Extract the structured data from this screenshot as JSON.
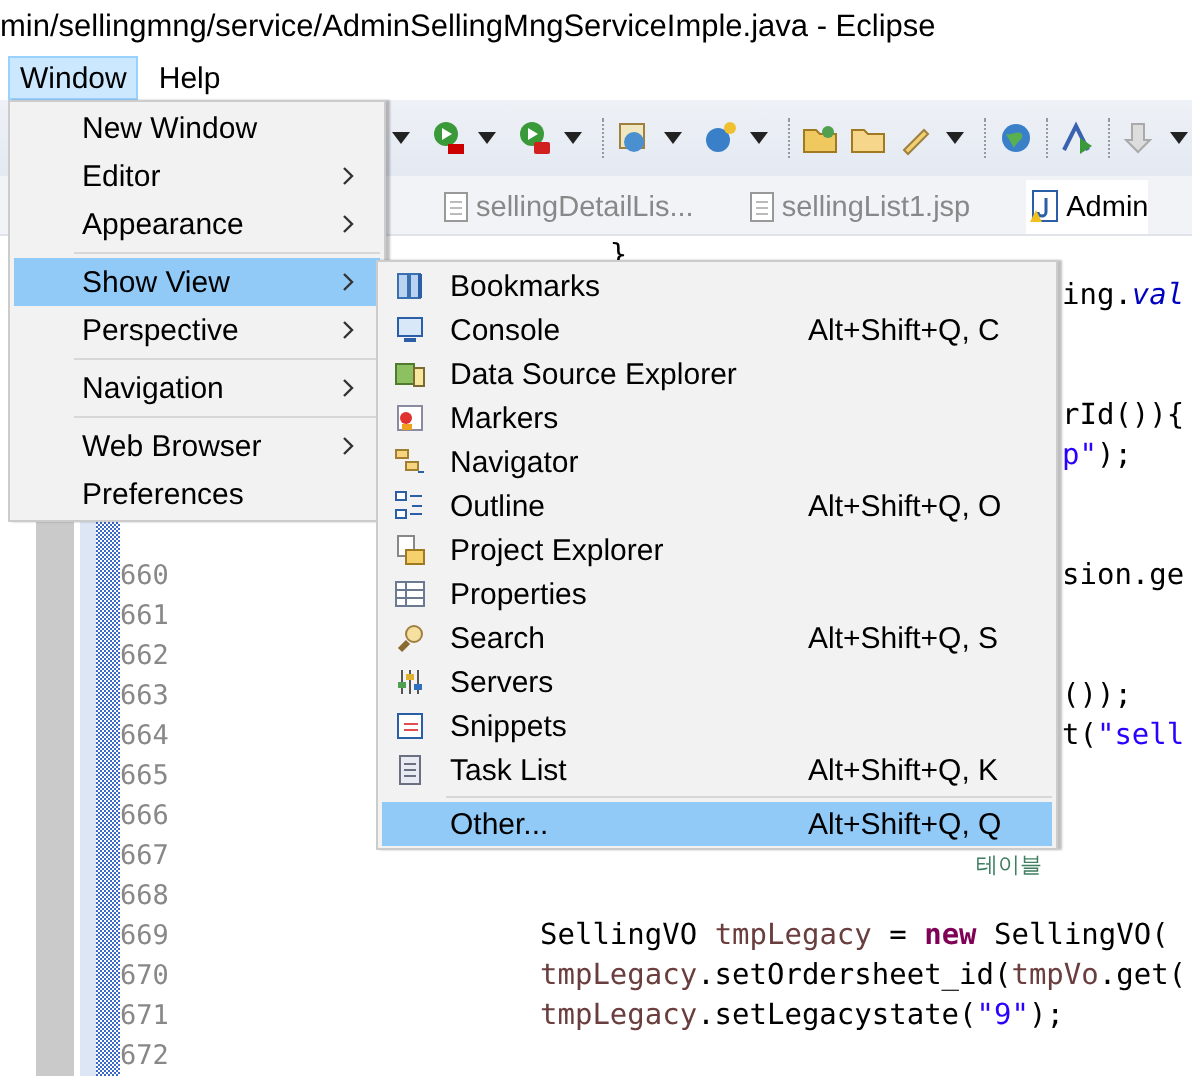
{
  "window": {
    "title": "min/sellingmng/service/AdminSellingMngServiceImple.java - Eclipse"
  },
  "menubar": [
    {
      "label": "Window",
      "selected": true
    },
    {
      "label": "Help",
      "selected": false
    }
  ],
  "tabs": [
    {
      "label": "sellingDetailLis...",
      "kind": "jsp",
      "selected": false
    },
    {
      "label": "sellingList1.jsp",
      "kind": "jsp",
      "selected": false
    },
    {
      "label": "Admin",
      "kind": "java",
      "selected": true
    }
  ],
  "editor": {
    "lines": [
      {
        "kind": "full",
        "tokens": [
          {
            "text": "    }",
            "kind": "plain"
          }
        ]
      },
      {
        "kind": "fragment",
        "tokens": [
          {
            "text": "ing.",
            "kind": "plain"
          },
          {
            "text": "val",
            "kind": "italic"
          }
        ]
      },
      {
        "kind": "blank"
      },
      {
        "kind": "blank"
      },
      {
        "kind": "fragment",
        "tokens": [
          {
            "text": "rId()){",
            "kind": "plain"
          }
        ]
      },
      {
        "kind": "fragment",
        "tokens": [
          {
            "text": "p\"",
            "kind": "string"
          },
          {
            "text": ");",
            "kind": "plain"
          }
        ]
      },
      {
        "kind": "blank"
      },
      {
        "kind": "blank"
      },
      {
        "kind": "fragment",
        "number": "660",
        "tokens": [
          {
            "text": "sion.ge",
            "kind": "plain"
          }
        ]
      },
      {
        "kind": "blank",
        "number": "661"
      },
      {
        "kind": "blank",
        "number": "662"
      },
      {
        "kind": "fragment",
        "number": "663",
        "tokens": [
          {
            "text": "());",
            "kind": "plain"
          }
        ]
      },
      {
        "kind": "fragment",
        "number": "664",
        "tokens": [
          {
            "text": "t(",
            "kind": "plain"
          },
          {
            "text": "\"sell",
            "kind": "string"
          }
        ]
      },
      {
        "kind": "blank",
        "number": "665"
      },
      {
        "kind": "blank",
        "number": "666"
      },
      {
        "kind": "comment_tail",
        "number": "667",
        "tokens": [
          {
            "text": "테이블",
            "kind": "comment"
          }
        ]
      },
      {
        "kind": "blank",
        "number": "668"
      },
      {
        "kind": "full",
        "number": "669",
        "tokens": [
          {
            "text": "SellingVO ",
            "kind": "plain"
          },
          {
            "text": "tmpLegacy",
            "kind": "field"
          },
          {
            "text": " = ",
            "kind": "plain"
          },
          {
            "text": "new",
            "kind": "keyword"
          },
          {
            "text": " SellingVO(",
            "kind": "plain"
          }
        ]
      },
      {
        "kind": "full",
        "number": "670",
        "tokens": [
          {
            "text": "tmpLegacy",
            "kind": "field"
          },
          {
            "text": ".setOrdersheet_id(",
            "kind": "plain"
          },
          {
            "text": "tmpVo",
            "kind": "field"
          },
          {
            "text": ".get(",
            "kind": "plain"
          }
        ]
      },
      {
        "kind": "full",
        "number": "671",
        "tokens": [
          {
            "text": "tmpLegacy",
            "kind": "field"
          },
          {
            "text": ".setLegacystate(",
            "kind": "plain"
          },
          {
            "text": "\"9\"",
            "kind": "string"
          },
          {
            "text": ");",
            "kind": "plain"
          }
        ]
      },
      {
        "kind": "blank",
        "number": "672"
      }
    ]
  },
  "window_menu": {
    "groups": [
      [
        {
          "label": "New Window",
          "submenu": false,
          "selected": false
        },
        {
          "label": "Editor",
          "submenu": true,
          "selected": false
        },
        {
          "label": "Appearance",
          "submenu": true,
          "selected": false
        }
      ],
      [
        {
          "label": "Show View",
          "submenu": true,
          "selected": true
        },
        {
          "label": "Perspective",
          "submenu": true,
          "selected": false
        }
      ],
      [
        {
          "label": "Navigation",
          "submenu": true,
          "selected": false
        }
      ],
      [
        {
          "label": "Web Browser",
          "submenu": true,
          "selected": false
        },
        {
          "label": "Preferences",
          "submenu": false,
          "selected": false
        }
      ]
    ]
  },
  "show_view_menu": {
    "groups": [
      [
        {
          "label": "Bookmarks",
          "selected": false
        },
        {
          "label": "Console",
          "shortcut": "Alt+Shift+Q, C",
          "selected": false
        },
        {
          "label": "Data Source Explorer",
          "selected": false
        },
        {
          "label": "Markers",
          "selected": false
        },
        {
          "label": "Navigator",
          "selected": false
        },
        {
          "label": "Outline",
          "shortcut": "Alt+Shift+Q, O",
          "selected": false
        },
        {
          "label": "Project Explorer",
          "selected": false
        },
        {
          "label": "Properties",
          "selected": false
        },
        {
          "label": "Search",
          "shortcut": "Alt+Shift+Q, S",
          "selected": false
        },
        {
          "label": "Servers",
          "selected": false
        },
        {
          "label": "Snippets",
          "selected": false
        },
        {
          "label": "Task List",
          "shortcut": "Alt+Shift+Q, K",
          "selected": false
        }
      ],
      [
        {
          "label": "Other...",
          "shortcut": "Alt+Shift+Q, Q",
          "selected": true
        }
      ]
    ]
  }
}
